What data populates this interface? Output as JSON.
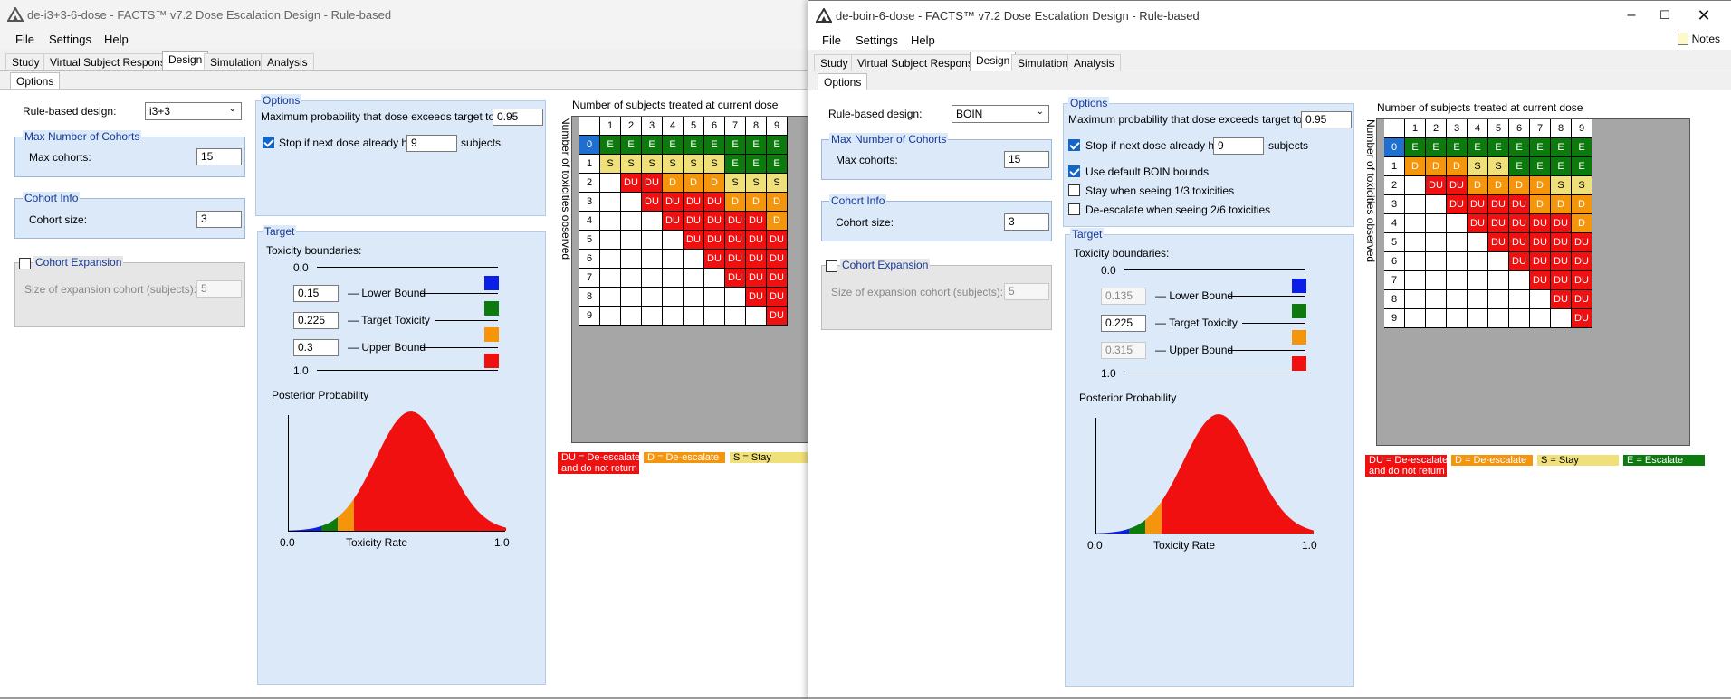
{
  "left": {
    "title": "de-i3+3-6-dose - FACTS™ v7.2 Dose Escalation Design - Rule-based",
    "menu": [
      "File",
      "Settings",
      "Help"
    ],
    "tabs": [
      "Study",
      "Virtual Subject Response",
      "Design",
      "Simulation",
      "Analysis"
    ],
    "subtab": "Options",
    "rule_label": "Rule-based design:",
    "rule_value": "i3+3",
    "max_group": "Max Number of Cohorts",
    "max_label": "Max cohorts:",
    "max_value": "15",
    "cohort_group": "Cohort Info",
    "cohort_label": "Cohort size:",
    "cohort_value": "3",
    "expansion_label": "Cohort Expansion",
    "expansion_size_label": "Size of expansion cohort (subjects):",
    "expansion_size_value": "5",
    "options_title": "Options",
    "maxprob_label": "Maximum probability that dose exceeds target toxicity:",
    "maxprob_value": "0.95",
    "stop_label": "Stop if next dose already has",
    "stop_value": "9",
    "stop_unit": "subjects",
    "target_title": "Target",
    "tox_label": "Toxicity boundaries:",
    "b0": "0.0",
    "b1": "1.0",
    "lower_value": "0.15",
    "lower_label": "— Lower Bound",
    "target_value": "0.225",
    "target_label": "— Target Toxicity",
    "upper_value": "0.3",
    "upper_label": "— Upper Bound",
    "post_label": "Posterior Probability",
    "x0": "0.0",
    "x1": "1.0",
    "xlabel": "Toxicity Rate",
    "grid_title": "Number of subjects treated at current dose",
    "grid_ylabel": "Number of toxicities observed",
    "legend": [
      {
        "text": "DU = De-escalate\nand do not return",
        "color": "#f01010"
      },
      {
        "text": "D = De-escalate",
        "color": "#f5950c"
      },
      {
        "text": "S = Stay",
        "color": "#f0e07a"
      }
    ]
  },
  "right": {
    "title": "de-boin-6-dose - FACTS™ v7.2 Dose Escalation Design - Rule-based",
    "menu": [
      "File",
      "Settings",
      "Help"
    ],
    "notes": "Notes",
    "tabs": [
      "Study",
      "Virtual Subject Response",
      "Design",
      "Simulation",
      "Analysis"
    ],
    "subtab": "Options",
    "rule_label": "Rule-based design:",
    "rule_value": "BOIN",
    "max_group": "Max Number of Cohorts",
    "max_label": "Max cohorts:",
    "max_value": "15",
    "cohort_group": "Cohort Info",
    "cohort_label": "Cohort size:",
    "cohort_value": "3",
    "expansion_label": "Cohort Expansion",
    "expansion_size_label": "Size of expansion cohort (subjects):",
    "expansion_size_value": "5",
    "options_title": "Options",
    "maxprob_label": "Maximum probability that dose exceeds target toxicity:",
    "maxprob_value": "0.95",
    "stop_label": "Stop if next dose already has",
    "stop_value": "9",
    "stop_unit": "subjects",
    "boin_label": "Use default BOIN bounds",
    "stay_label": "Stay when seeing 1/3 toxicities",
    "deesc_label": "De-escalate when seeing 2/6 toxicities",
    "target_title": "Target",
    "tox_label": "Toxicity boundaries:",
    "b0": "0.0",
    "b1": "1.0",
    "lower_value": "0.135",
    "lower_label": "— Lower Bound",
    "target_value": "0.225",
    "target_label": "— Target Toxicity",
    "upper_value": "0.315",
    "upper_label": "— Upper Bound",
    "post_label": "Posterior Probability",
    "x0": "0.0",
    "x1": "1.0",
    "xlabel": "Toxicity Rate",
    "grid_title": "Number of subjects treated at current dose",
    "grid_ylabel": "Number of toxicities observed",
    "legend": [
      {
        "text": "DU = De-escalate\nand do not return",
        "color": "#f01010"
      },
      {
        "text": "D = De-escalate",
        "color": "#f5950c"
      },
      {
        "text": "S = Stay",
        "color": "#f0e07a"
      },
      {
        "text": "E = Escalate",
        "color": "#0c7a0c"
      }
    ]
  },
  "colors": {
    "lower": "#0a1ee8",
    "target": "#0c7a0c",
    "upper": "#f5950c",
    "above": "#f01010"
  },
  "grids": {
    "cols": [
      "1",
      "2",
      "3",
      "4",
      "5",
      "6",
      "7",
      "8",
      "9"
    ],
    "rows": [
      "0",
      "1",
      "2",
      "3",
      "4",
      "5",
      "6",
      "7",
      "8",
      "9"
    ],
    "left": [
      [
        "E",
        "E",
        "E",
        "E",
        "E",
        "E",
        "E",
        "E",
        "E"
      ],
      [
        "S",
        "S",
        "S",
        "S",
        "S",
        "S",
        "E",
        "E",
        "E"
      ],
      [
        "",
        "DU",
        "DU",
        "D",
        "D",
        "D",
        "S",
        "S",
        "S"
      ],
      [
        "",
        "",
        "DU",
        "DU",
        "DU",
        "DU",
        "D",
        "D",
        "D"
      ],
      [
        "",
        "",
        "",
        "DU",
        "DU",
        "DU",
        "DU",
        "DU",
        "D"
      ],
      [
        "",
        "",
        "",
        "",
        "DU",
        "DU",
        "DU",
        "DU",
        "DU"
      ],
      [
        "",
        "",
        "",
        "",
        "",
        "DU",
        "DU",
        "DU",
        "DU"
      ],
      [
        "",
        "",
        "",
        "",
        "",
        "",
        "DU",
        "DU",
        "DU"
      ],
      [
        "",
        "",
        "",
        "",
        "",
        "",
        "",
        "DU",
        "DU"
      ],
      [
        "",
        "",
        "",
        "",
        "",
        "",
        "",
        "",
        "DU"
      ]
    ],
    "right": [
      [
        "E",
        "E",
        "E",
        "E",
        "E",
        "E",
        "E",
        "E",
        "E"
      ],
      [
        "D",
        "D",
        "D",
        "S",
        "S",
        "E",
        "E",
        "E",
        "E"
      ],
      [
        "",
        "DU",
        "DU",
        "D",
        "D",
        "D",
        "D",
        "S",
        "S"
      ],
      [
        "",
        "",
        "DU",
        "DU",
        "DU",
        "DU",
        "D",
        "D",
        "D"
      ],
      [
        "",
        "",
        "",
        "DU",
        "DU",
        "DU",
        "DU",
        "DU",
        "D"
      ],
      [
        "",
        "",
        "",
        "",
        "DU",
        "DU",
        "DU",
        "DU",
        "DU"
      ],
      [
        "",
        "",
        "",
        "",
        "",
        "DU",
        "DU",
        "DU",
        "DU"
      ],
      [
        "",
        "",
        "",
        "",
        "",
        "",
        "DU",
        "DU",
        "DU"
      ],
      [
        "",
        "",
        "",
        "",
        "",
        "",
        "",
        "DU",
        "DU"
      ],
      [
        "",
        "",
        "",
        "",
        "",
        "",
        "",
        "",
        "DU"
      ]
    ]
  }
}
